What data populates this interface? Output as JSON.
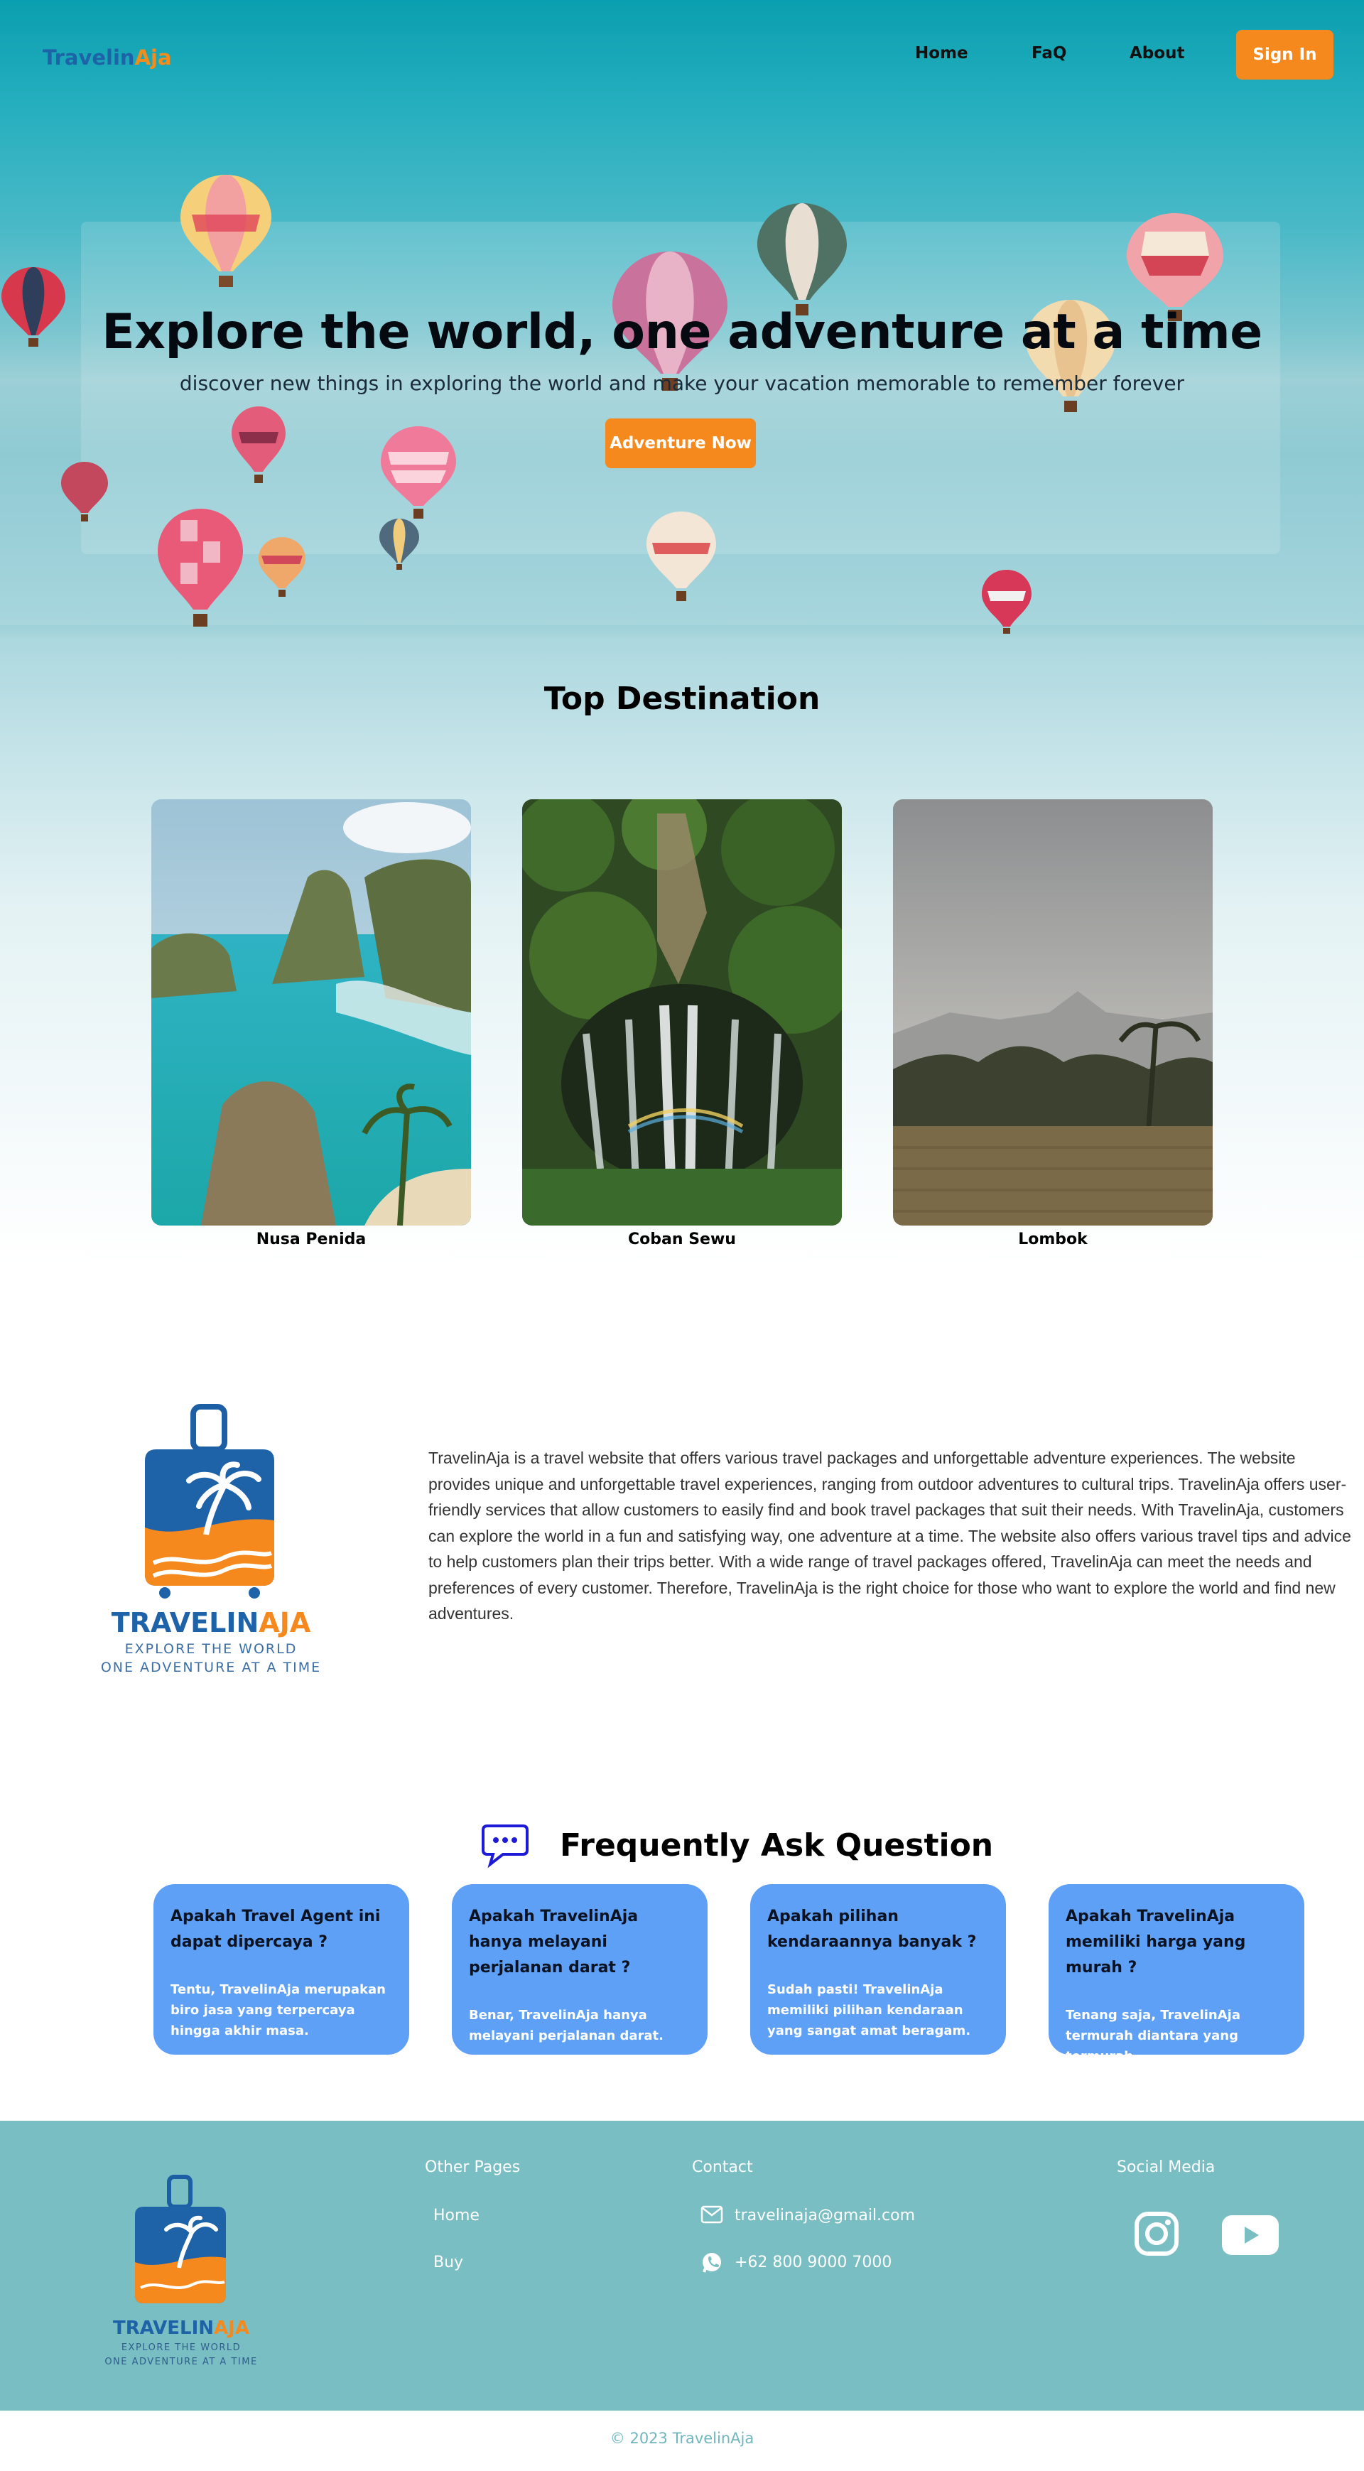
{
  "brand": {
    "part1": "Travelin",
    "part2": "Aja",
    "color1": "#1e63a8",
    "color2": "#f28c1a"
  },
  "nav": {
    "home": "Home",
    "faq": "FaQ",
    "about": "About",
    "signin": "Sign In"
  },
  "hero": {
    "title": "Explore the world, one adventure at a time",
    "subtitle": "discover new things in exploring the world and make your vacation memorable to remember forever",
    "cta": "Adventure Now"
  },
  "destinations": {
    "title": "Top Destination",
    "items": [
      {
        "name": "Nusa Penida"
      },
      {
        "name": "Coban Sewu"
      },
      {
        "name": "Lombok"
      }
    ]
  },
  "about": {
    "logo_name_1": "TRAVELIN",
    "logo_name_2": "AJA",
    "logo_tag_1": "EXPLORE THE WORLD",
    "logo_tag_2": "ONE ADVENTURE AT A TIME",
    "text": "TravelinAja is a travel website that offers various travel packages and unforgettable adventure experiences. The website provides unique and unforgettable travel experiences, ranging from outdoor adventures to cultural trips. TravelinAja offers user-friendly services that allow customers to easily find and book travel packages that suit their needs. With TravelinAja, customers can explore the world in a fun and satisfying way, one adventure at a time. The website also offers various travel tips and advice to help customers plan their trips better. With a wide range of travel packages offered, TravelinAja can meet the needs and preferences of every customer. Therefore, TravelinAja is the right choice for those who want to explore the world and find new adventures."
  },
  "faq": {
    "title": "Frequently Ask Question",
    "items": [
      {
        "q": "Apakah Travel Agent ini dapat dipercaya ?",
        "a": "Tentu, TravelinAja merupakan biro jasa yang terpercaya hingga akhir masa."
      },
      {
        "q": "Apakah TravelinAja hanya melayani perjalanan darat ?",
        "a": "Benar, TravelinAja hanya melayani perjalanan darat."
      },
      {
        "q": "Apakah pilihan kendaraannya banyak ?",
        "a": "Sudah pasti! TravelinAja memiliki pilihan kendaraan yang sangat amat beragam."
      },
      {
        "q": "Apakah TravelinAja memiliki harga yang murah ?",
        "a": "Tenang saja, TravelinAja termurah diantara yang termurah."
      }
    ]
  },
  "footer": {
    "other_pages_title": "Other Pages",
    "links": [
      "Home",
      "Buy"
    ],
    "contact_title": "Contact",
    "email": "travelinaja@gmail.com",
    "phone": "+62 800 9000 7000",
    "social_title": "Social Media",
    "copyright": "© 2023 TravelinAja"
  },
  "colors": {
    "accent": "#f5891d",
    "faq_card": "#5fa0f7",
    "footer_bg": "#79bec3"
  }
}
